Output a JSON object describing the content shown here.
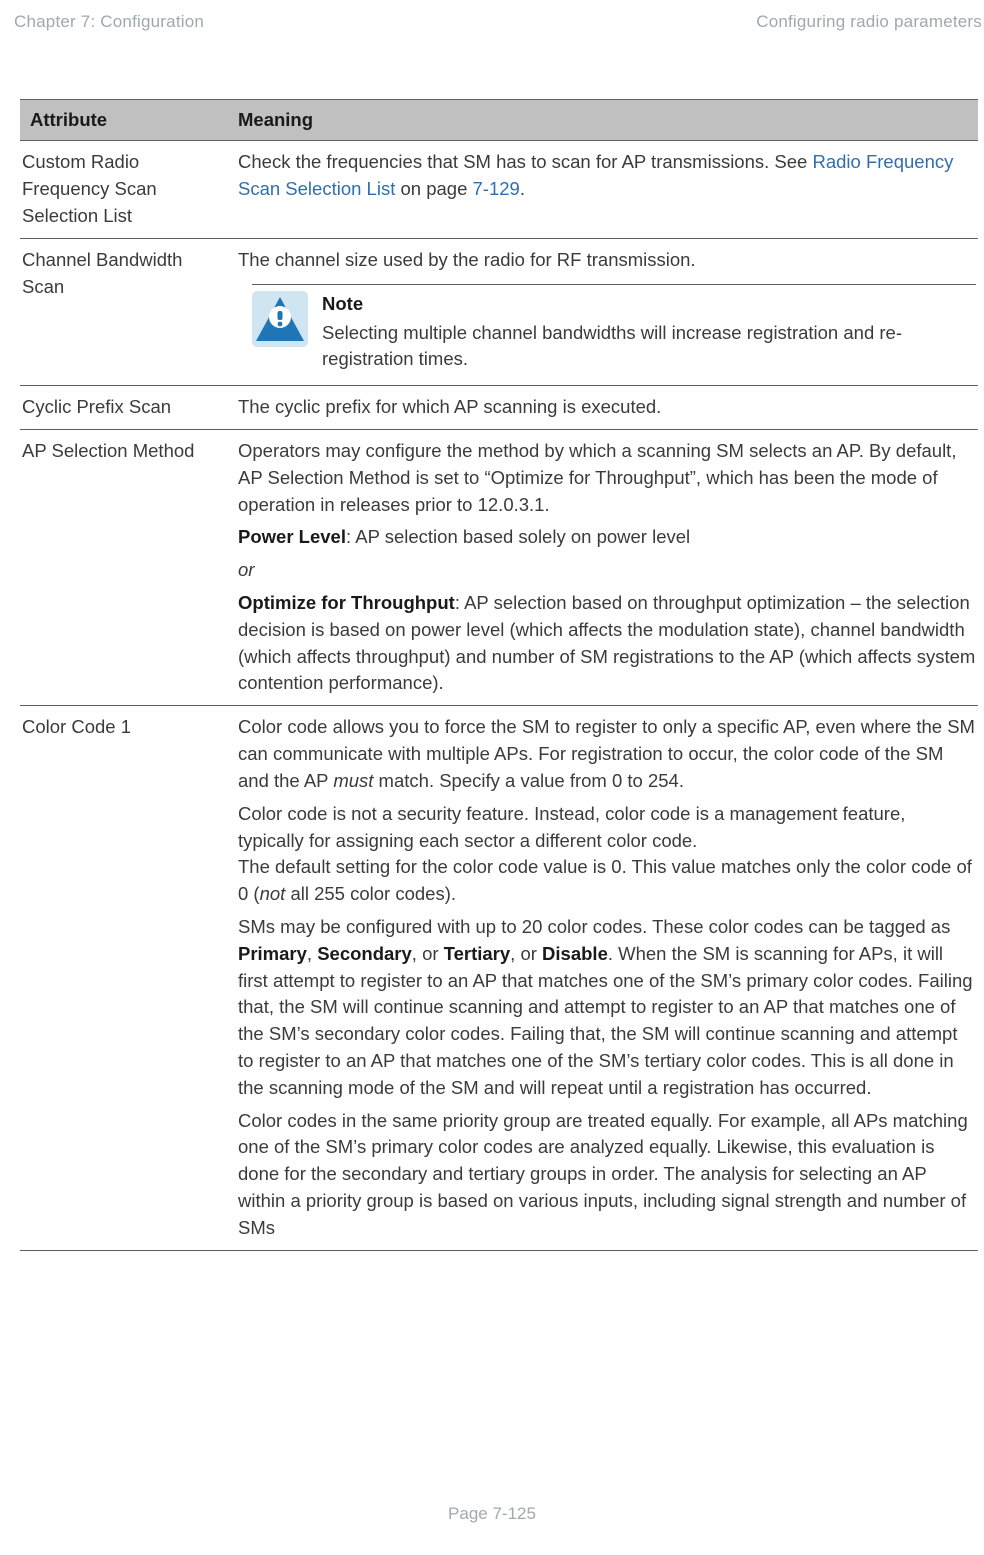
{
  "header": {
    "left": "Chapter 7:  Configuration",
    "right": "Configuring radio parameters"
  },
  "table": {
    "columns": {
      "attribute": "Attribute",
      "meaning": "Meaning"
    },
    "rows": {
      "custom_radio": {
        "attribute": "Custom Radio Frequency Scan Selection List",
        "m1a": "Check the frequencies that SM has to scan for AP transmissions. See ",
        "m1_link": "Radio Frequency Scan Selection List",
        "m1b": " on page ",
        "m1_page": "7-129",
        "m1c": "."
      },
      "chan_bw": {
        "attribute": "Channel Bandwidth Scan",
        "m1": "The channel size used by the radio for RF transmission.",
        "note_title": "Note",
        "note_body": "Selecting multiple channel bandwidths will increase registration and re-registration times."
      },
      "cyclic": {
        "attribute": "Cyclic Prefix Scan",
        "m1": "The cyclic prefix for which AP scanning is executed."
      },
      "ap_sel": {
        "attribute": "AP Selection Method",
        "p1": "Operators may configure the method by which a scanning SM selects an AP. By default, AP Selection Method is set to “Optimize for Throughput”, which has been the mode of operation in releases prior to 12.0.3.1.",
        "p2_bold": "Power Level",
        "p2_rest": ": AP selection based solely on power level",
        "p3": "or",
        "p4_bold": "Optimize for Throughput",
        "p4_rest": ":  AP selection based on throughput optimization – the selection decision is based on power level (which affects the modulation state), channel bandwidth (which affects throughput) and number of SM registrations to the AP (which affects system contention performance)."
      },
      "color_code": {
        "attribute": "Color Code 1",
        "p1a": "Color code allows you to force the SM to register to only a specific AP, even where the SM can communicate with multiple APs. For registration to occur, the color code of the SM and the AP ",
        "p1_it": "must",
        "p1b": " match. Specify a value from 0 to 254.",
        "p2a": "Color code is not a security feature. Instead, color code is a management feature, typically for assigning each sector a different color code.",
        "p2b_a": "The default setting for the color code value is 0. This value matches only the color code of 0 (",
        "p2b_it": "not",
        "p2b_b": " all 255 color codes).",
        "p3a": "SMs may be configured with up to 20 color codes. These color codes can be tagged as ",
        "p3_b1": "Primary",
        "p3_s1": ", ",
        "p3_b2": "Secondary",
        "p3_s2": ", or ",
        "p3_b3": "Tertiary",
        "p3_s3": ", or ",
        "p3_b4": "Disable",
        "p3b": ". When the SM is scanning for APs, it will first attempt to register to an AP that matches one of the SM’s primary color codes. Failing that, the SM will continue scanning and attempt to register to an AP that matches one of the SM’s secondary color codes. Failing that, the SM will continue scanning and attempt to register to an AP that matches one of the SM’s tertiary color codes. This is all done in the scanning mode of the SM and will repeat until a registration has occurred.",
        "p4": "Color codes in the same priority group are treated equally.  For example, all APs matching one of the SM’s primary color codes are analyzed equally.  Likewise, this evaluation is done for the secondary and tertiary groups in order.  The analysis for selecting an AP within a priority group is based on various inputs, including signal strength and number of SMs"
      }
    }
  },
  "footer": "Page 7-125"
}
